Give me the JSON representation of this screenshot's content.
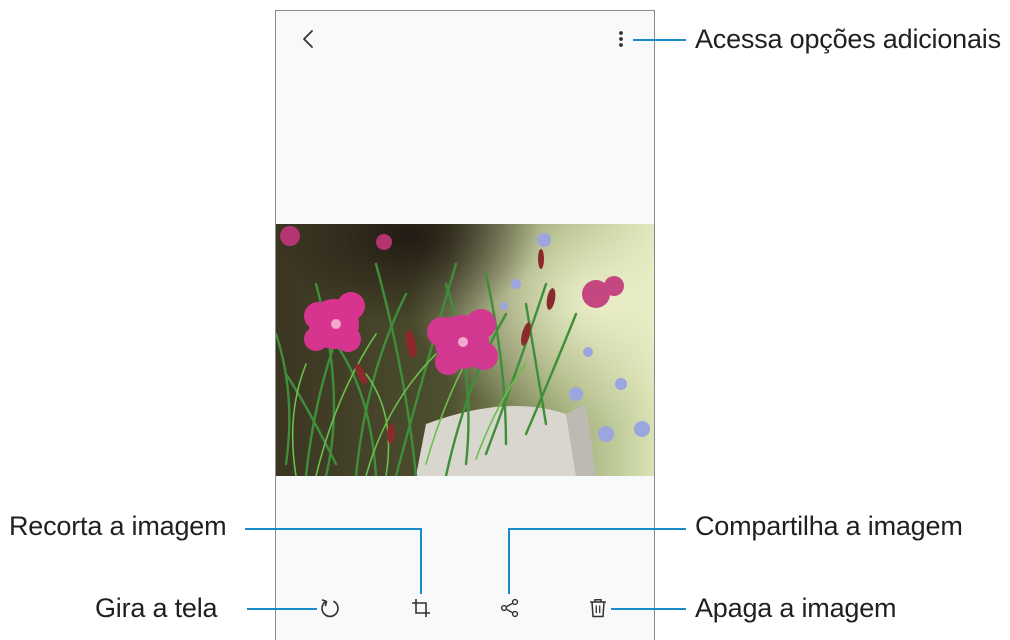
{
  "callouts": {
    "more_options": "Acessa opções adicionais",
    "crop": "Recorta a imagem",
    "share": "Compartilha a imagem",
    "rotate": "Gira a tela",
    "delete": "Apaga a imagem"
  },
  "icons": {
    "back": "chevron-left-icon",
    "more": "more-vertical-icon",
    "rotate": "rotate-icon",
    "crop": "crop-icon",
    "share": "share-icon",
    "delete": "trash-icon"
  },
  "colors": {
    "leader": "#1a8bc9",
    "screen_bg": "#f8f9fa",
    "text": "#231f20"
  }
}
